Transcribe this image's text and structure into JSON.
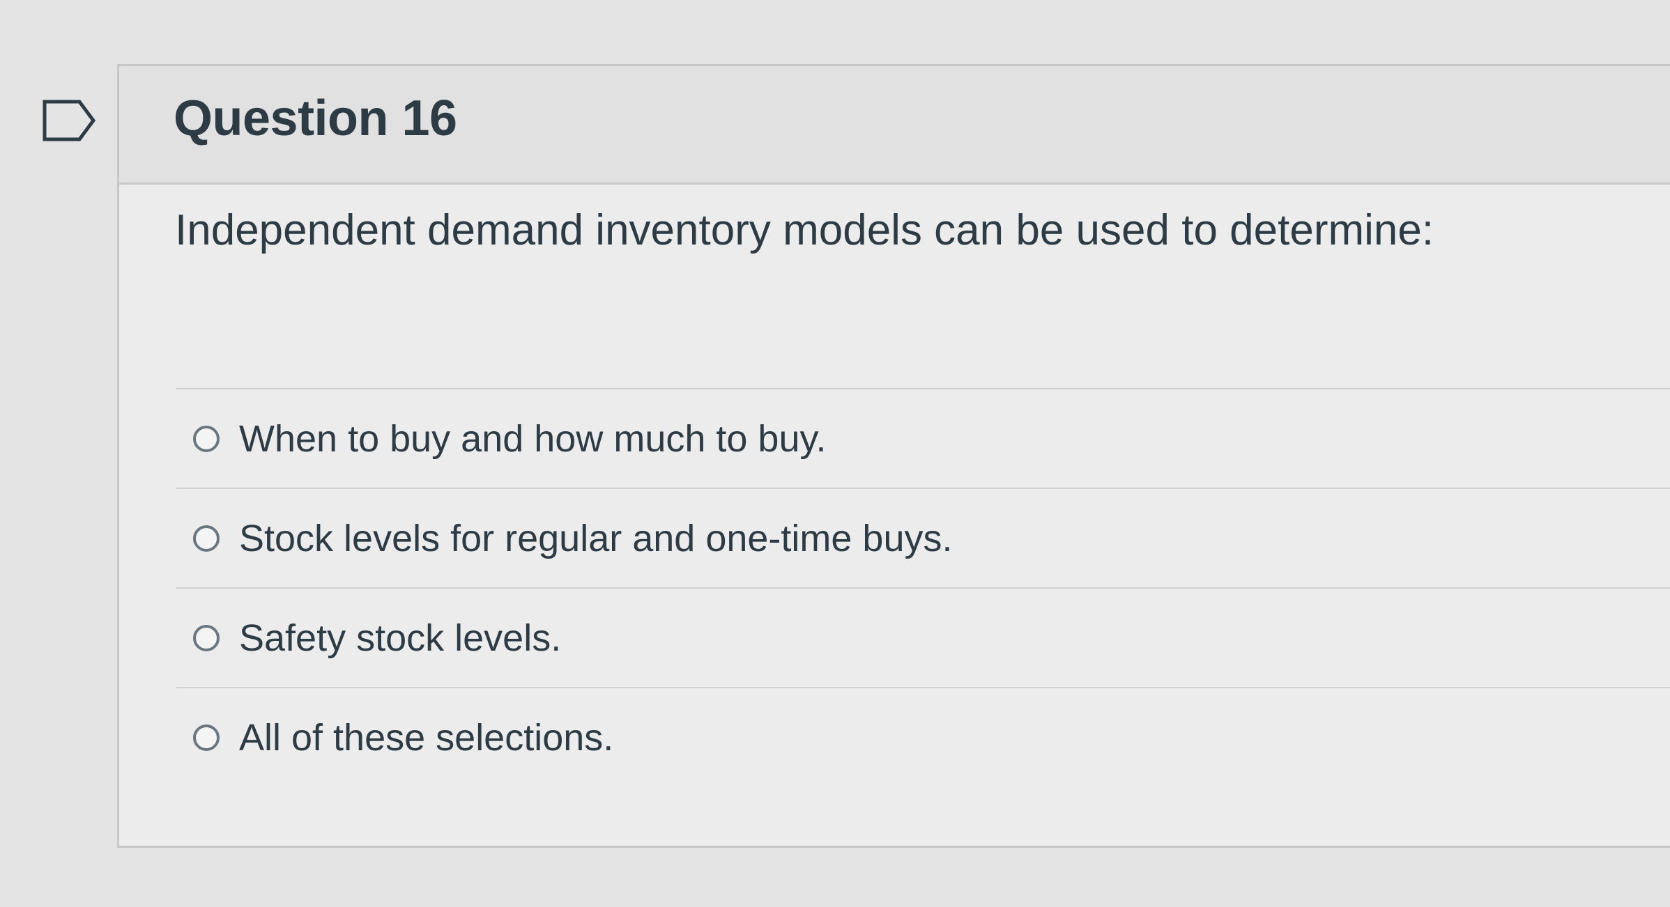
{
  "question": {
    "title": "Question 16",
    "text": "Independent demand inventory models can be used to determine:",
    "flag_icon": "flag-bookmark-icon",
    "answers": [
      {
        "label": "When to buy and how much to buy.",
        "selected": false
      },
      {
        "label": "Stock levels for regular and one-time buys.",
        "selected": false
      },
      {
        "label": "Safety stock levels.",
        "selected": false
      },
      {
        "label": "All of these selections.",
        "selected": false
      }
    ]
  },
  "colors": {
    "text": "#2d3b45",
    "header_background": "#e1e1e1",
    "body_background": "#ececec",
    "border": "#c7c7c7"
  }
}
